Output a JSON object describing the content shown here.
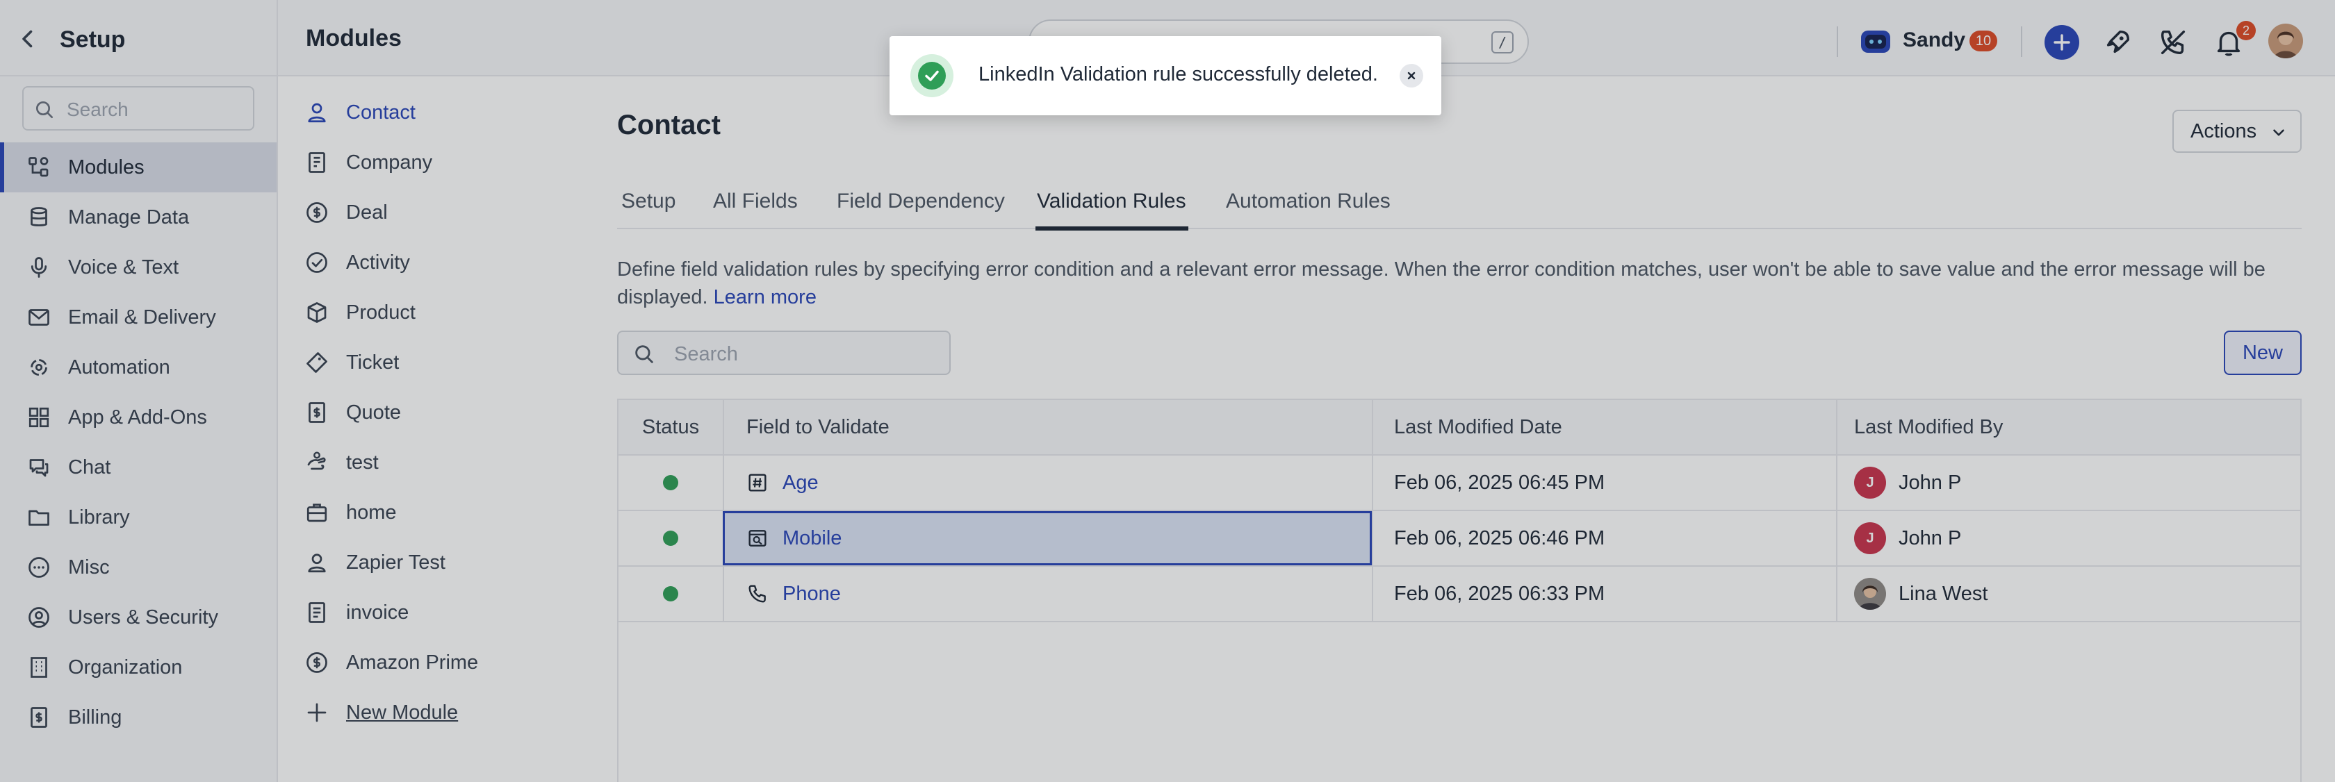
{
  "app": {
    "setup_title": "Setup",
    "page_title": "Modules",
    "global_search_shortcut": "/"
  },
  "user": {
    "name": "Sandy",
    "count": "10",
    "notification_count": "2"
  },
  "setup_nav": {
    "search_placeholder": "Search",
    "items": [
      {
        "label": "Modules",
        "icon": "modules-icon"
      },
      {
        "label": "Manage Data",
        "icon": "database-icon"
      },
      {
        "label": "Voice & Text",
        "icon": "microphone-icon"
      },
      {
        "label": "Email & Delivery",
        "icon": "mail-icon"
      },
      {
        "label": "Automation",
        "icon": "automation-icon"
      },
      {
        "label": "App & Add-Ons",
        "icon": "apps-icon"
      },
      {
        "label": "Chat",
        "icon": "chat-icon"
      },
      {
        "label": "Library",
        "icon": "folder-icon"
      },
      {
        "label": "Misc",
        "icon": "more-icon"
      },
      {
        "label": "Users & Security",
        "icon": "user-circle-icon"
      },
      {
        "label": "Organization",
        "icon": "building-icon"
      },
      {
        "label": "Billing",
        "icon": "billing-icon"
      }
    ],
    "active": "Modules"
  },
  "modules": {
    "items": [
      {
        "label": "Contact",
        "icon": "person-icon"
      },
      {
        "label": "Company",
        "icon": "company-icon"
      },
      {
        "label": "Deal",
        "icon": "dollar-icon"
      },
      {
        "label": "Activity",
        "icon": "check-circle-icon"
      },
      {
        "label": "Product",
        "icon": "box-icon"
      },
      {
        "label": "Ticket",
        "icon": "ticket-icon"
      },
      {
        "label": "Quote",
        "icon": "quote-icon"
      },
      {
        "label": "test",
        "icon": "hand-icon"
      },
      {
        "label": "home",
        "icon": "briefcase-icon"
      },
      {
        "label": "Zapier Test",
        "icon": "user-card-icon"
      },
      {
        "label": "invoice",
        "icon": "invoice-icon"
      },
      {
        "label": "Amazon Prime",
        "icon": "dollar-icon"
      }
    ],
    "new_module_label": "New Module",
    "active": "Contact"
  },
  "main": {
    "title": "Contact",
    "actions_label": "Actions",
    "tabs": [
      {
        "label": "Setup"
      },
      {
        "label": "All Fields"
      },
      {
        "label": "Field Dependency"
      },
      {
        "label": "Validation Rules"
      },
      {
        "label": "Automation Rules"
      }
    ],
    "active_tab": "Validation Rules",
    "description": "Define field validation rules by specifying error condition and a relevant error message. When the error condition matches, user won't be able to save value and the error message will be displayed.",
    "learn_more": "Learn more",
    "search_placeholder": "Search",
    "new_label": "New",
    "table": {
      "columns": [
        "Status",
        "Field to Validate",
        "Last Modified Date",
        "Last Modified By"
      ],
      "rows": [
        {
          "status": "active",
          "field": "Age",
          "field_icon": "hash-icon",
          "date": "Feb 06, 2025 06:45 PM",
          "by": "John P",
          "by_initial": "J"
        },
        {
          "status": "active",
          "field": "Mobile",
          "field_icon": "phone-card-icon",
          "date": "Feb 06, 2025 06:46 PM",
          "by": "John P",
          "by_initial": "J"
        },
        {
          "status": "active",
          "field": "Phone",
          "field_icon": "phone-icon",
          "date": "Feb 06, 2025 06:33 PM",
          "by": "Lina West",
          "by_initial": ""
        }
      ],
      "selected_row": "Mobile"
    }
  },
  "toast": {
    "message": "LinkedIn Validation rule successfully deleted.",
    "type": "success"
  },
  "colors": {
    "accent": "#2945b8",
    "success": "#2f9e57",
    "badge": "#dc4a26",
    "avatar_j": "#c8344d"
  }
}
